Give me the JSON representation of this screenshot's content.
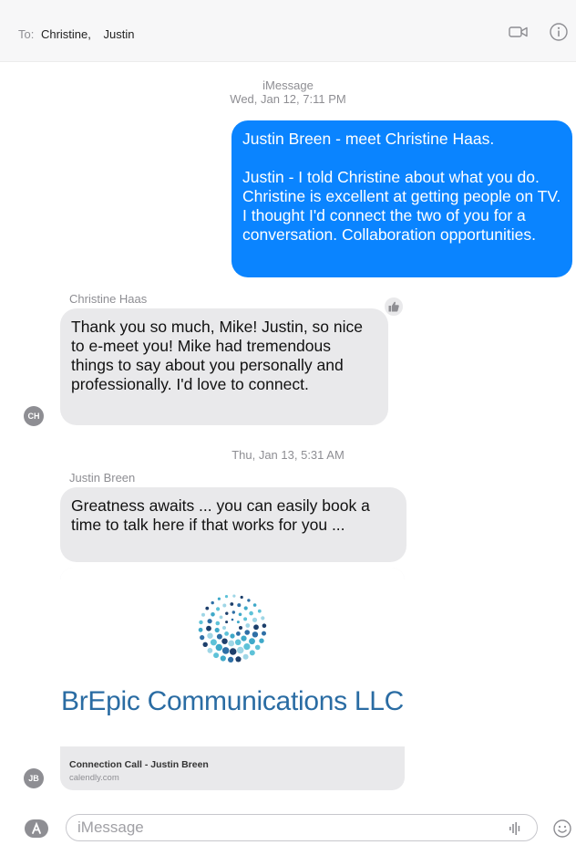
{
  "header": {
    "to_label": "To:",
    "recipients": [
      "Christine,",
      "Justin"
    ]
  },
  "thread": {
    "service": "iMessage",
    "timestamp_1": "Wed, Jan 12, 7:11 PM",
    "timestamp_2": "Thu, Jan 13, 5:31 AM"
  },
  "messages": [
    {
      "direction": "outgoing",
      "paragraphs": [
        "Justin Breen - meet Christine Haas.",
        "Justin - I told Christine about what you do. Christine is excellent at getting people on TV. I thought I'd connect the two of you for a conversation. Collaboration opportunities."
      ]
    },
    {
      "direction": "incoming",
      "sender": "Christine Haas",
      "avatar_initials": "CH",
      "text": "Thank you so much, Mike!  Justin, so nice to e-meet you!  Mike had tremendous things to say about you personally and professionally.  I'd love to connect.",
      "tapback": "thumbs-up-icon"
    },
    {
      "direction": "incoming",
      "sender": "Justin Breen",
      "avatar_initials": "JB",
      "text": "Greatness awaits ... you can easily book a time to talk here if that works for you ...",
      "link_preview": {
        "brand": "BrEpic Communications LLC",
        "title": "Connection Call - Justin Breen",
        "domain": "calendly.com"
      }
    }
  ],
  "composer": {
    "placeholder": "iMessage"
  },
  "colors": {
    "outgoing_bubble": "#0a84ff",
    "incoming_bubble": "#e9e9eb",
    "brand_text": "#2a6ca3"
  }
}
